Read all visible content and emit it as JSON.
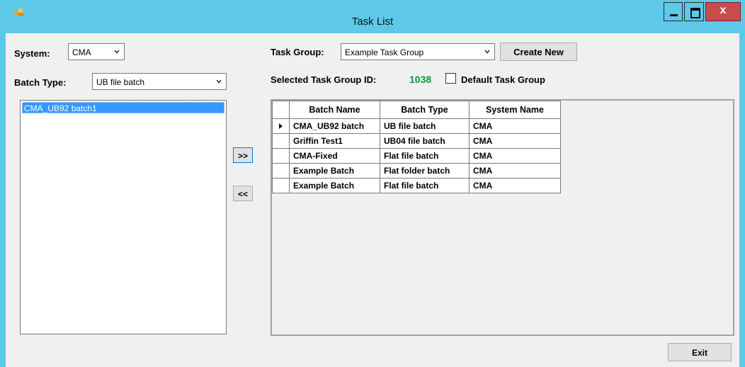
{
  "window": {
    "title": "Task List"
  },
  "left": {
    "system_label": "System:",
    "system_value": "CMA",
    "batch_type_label": "Batch Type:",
    "batch_type_value": "UB file batch",
    "list_items": [
      "CMA_UB92 batch1"
    ]
  },
  "buttons": {
    "move_right": ">>",
    "move_left": "<<",
    "create_new": "Create New",
    "exit": "Exit"
  },
  "right": {
    "task_group_label": "Task Group:",
    "task_group_value": "Example Task Group",
    "selected_id_label": "Selected Task Group ID:",
    "selected_id_value": "1038",
    "default_label": "Default Task Group",
    "default_checked": false
  },
  "grid": {
    "columns": [
      "Batch Name",
      "Batch Type",
      "System Name"
    ],
    "rows": [
      [
        "CMA_UB92 batch",
        "UB file batch",
        "CMA"
      ],
      [
        "Griffin Test1",
        "UB04 file batch",
        "CMA"
      ],
      [
        "CMA-Fixed",
        "Flat file batch",
        "CMA"
      ],
      [
        "Example Batch",
        "Flat folder batch",
        "CMA"
      ],
      [
        "Example Batch",
        "Flat file batch",
        "CMA"
      ]
    ],
    "current_row": 0
  },
  "colors": {
    "title_bar": "#5ec8e8",
    "selection": "#3399ff",
    "group_id": "#139a3a"
  },
  "icons": [
    "app-icon",
    "minimize-icon",
    "maximize-icon",
    "close-icon",
    "chevron-down-icon",
    "row-pointer-icon"
  ]
}
